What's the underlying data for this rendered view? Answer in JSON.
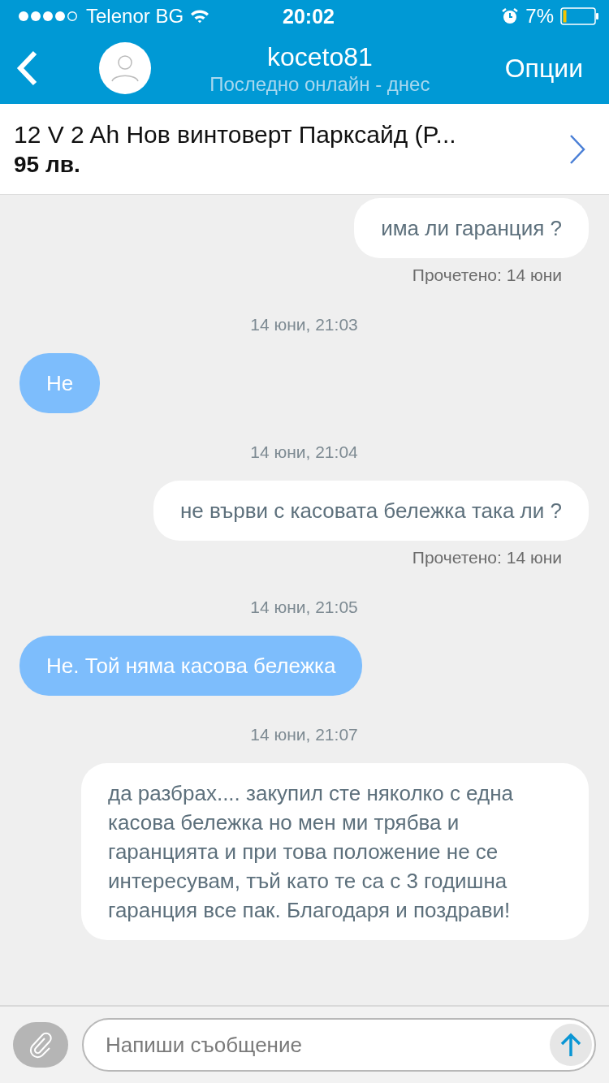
{
  "status_bar": {
    "carrier": "Telenor BG",
    "time": "20:02",
    "battery_percent": "7%"
  },
  "header": {
    "name": "koceto81",
    "last_seen": "Последно онлайн - днес",
    "options": "Опции"
  },
  "listing": {
    "title": "12 V 2 Ah Нов винтоверт Парксайд (P...",
    "price": "95 лв."
  },
  "messages": [
    {
      "kind": "outgoing",
      "text": "има ли гаранция ?"
    },
    {
      "kind": "read",
      "text": "Прочетено: 14 юни"
    },
    {
      "kind": "timestamp",
      "text": "14 юни, 21:03"
    },
    {
      "kind": "incoming",
      "text": "Не"
    },
    {
      "kind": "timestamp",
      "text": "14 юни, 21:04"
    },
    {
      "kind": "outgoing",
      "text": "не върви с касовата бележка така ли ?"
    },
    {
      "kind": "read",
      "text": "Прочетено: 14 юни"
    },
    {
      "kind": "timestamp",
      "text": "14 юни, 21:05"
    },
    {
      "kind": "incoming",
      "text": "Не. Той няма касова бележка"
    },
    {
      "kind": "timestamp",
      "text": "14 юни, 21:07"
    },
    {
      "kind": "outgoing",
      "text": "да разбрах.... закупил сте няколко с една касова бележка но мен ми трябва и гаранцията и при това положение не се интересувам, тъй като те са с 3 годишна гаранция все пак. Благодаря и поздрави!"
    }
  ],
  "composer": {
    "placeholder": "Напиши съобщение"
  }
}
